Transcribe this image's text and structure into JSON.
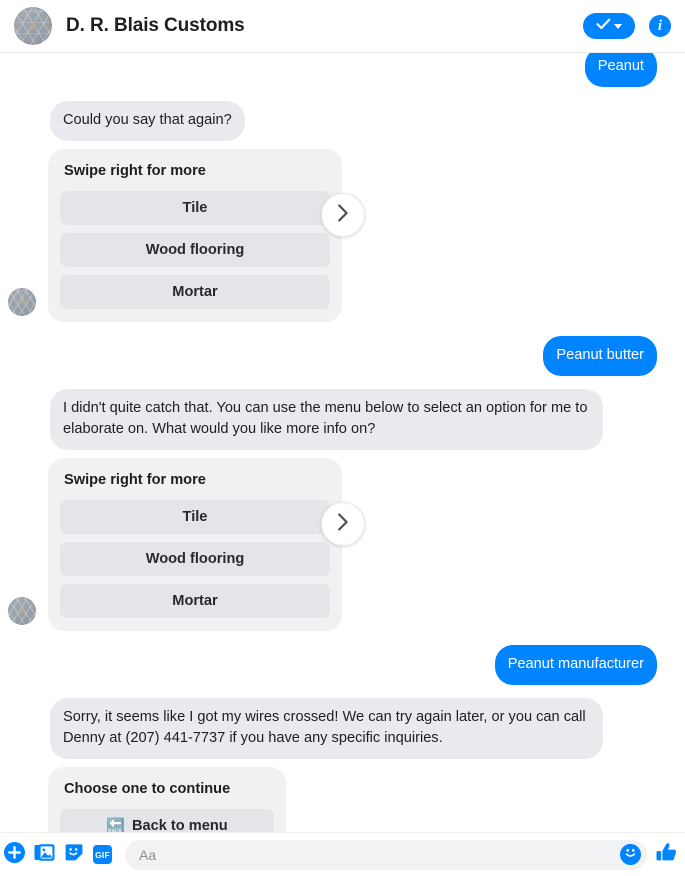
{
  "header": {
    "title": "D. R. Blais Customs",
    "avatar_name": "page-avatar",
    "check_button_label": "",
    "info_button_label": "i"
  },
  "thread": {
    "messages": [
      {
        "type": "bubble",
        "side": "out",
        "text": "Peanut",
        "clipped_top": true
      },
      {
        "type": "bubble",
        "side": "in",
        "text": "Could you say that again?"
      },
      {
        "type": "carousel",
        "title": "Swipe right for more",
        "options": [
          "Tile",
          "Wood flooring",
          "Mortar"
        ],
        "next_label": "›"
      },
      {
        "type": "bubble",
        "side": "out",
        "text": "Peanut butter"
      },
      {
        "type": "bubble",
        "side": "in",
        "text": "I didn't quite catch that. You can use the menu below to select an option for me to elaborate on. What would you like more info on?"
      },
      {
        "type": "carousel",
        "title": "Swipe right for more",
        "options": [
          "Tile",
          "Wood flooring",
          "Mortar"
        ],
        "next_label": "›"
      },
      {
        "type": "bubble",
        "side": "out",
        "text": "Peanut manufacturer"
      },
      {
        "type": "bubble",
        "side": "in",
        "text": "Sorry, it seems like I got my wires crossed! We can try again later, or you can call Denny at (207) 441-7737 if you have any specific inquiries."
      },
      {
        "type": "menu_card",
        "title": "Choose one to continue",
        "option_emoji": "🔙",
        "option_label": "Back to menu"
      }
    ]
  },
  "composer": {
    "placeholder": "Aa",
    "value": "",
    "gif_label": "GIF",
    "icons": [
      "plus-circle-icon",
      "photo-icon",
      "sticker-icon",
      "gif-icon",
      "emoji-icon",
      "thumbs-up-icon"
    ]
  },
  "colors": {
    "accent_blue": "#0084ff",
    "incoming_bubble": "#e9eaed",
    "card_bg": "#eff1f3",
    "card_button_bg": "#e3e5e9",
    "text_primary": "#1c1e21"
  }
}
